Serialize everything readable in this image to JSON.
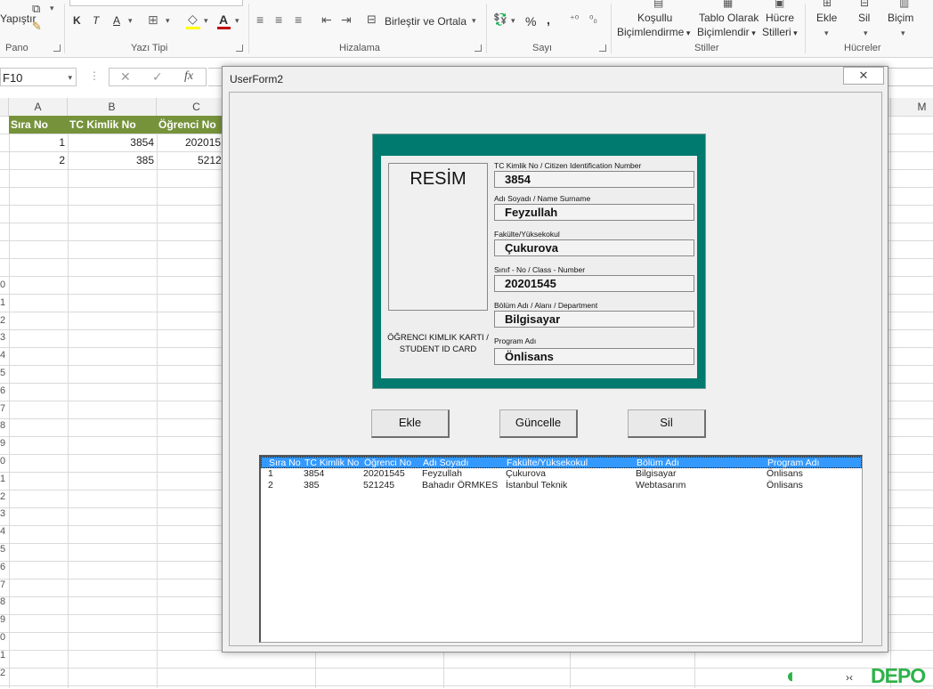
{
  "ribbon": {
    "clipboard": {
      "paste_label": "Yapıştır",
      "group_label": "Pano"
    },
    "font": {
      "group_label": "Yazı Tipi",
      "bold": "K",
      "italic": "T",
      "underline": "A",
      "fill_color": "#ffff00",
      "font_color": "#c00000"
    },
    "alignment": {
      "group_label": "Hizalama",
      "merge_label": "Birleştir ve Ortala"
    },
    "number": {
      "group_label": "Sayı",
      "percent": "%",
      "comma": ","
    },
    "styles": {
      "group_label": "Stiller",
      "conditional_line1": "Koşullu",
      "conditional_line2": "Biçimlendirme",
      "table_line1": "Tablo Olarak",
      "table_line2": "Biçimlendir",
      "cell_line1": "Hücre",
      "cell_line2": "Stilleri"
    },
    "cells": {
      "group_label": "Hücreler",
      "insert": "Ekle",
      "delete": "Sil",
      "format": "Biçim"
    }
  },
  "formula_bar": {
    "name_box": "F10",
    "cancel": "✕",
    "enter": "✓",
    "fx": "fx"
  },
  "sheet": {
    "columns": [
      "A",
      "B",
      "C",
      "M"
    ],
    "headers": [
      "Sıra No",
      "TC Kimlik No",
      "Öğrenci No"
    ],
    "rows": [
      [
        "1",
        "3854",
        "202015"
      ],
      [
        "2",
        "385",
        "5212"
      ]
    ],
    "row_numbers": [
      "0",
      "1",
      "2",
      "3",
      "4",
      "5",
      "6",
      "7",
      "8",
      "9",
      "0",
      "1",
      "2",
      "3",
      "4",
      "5",
      "6",
      "7",
      "8",
      "9",
      "0",
      "1",
      "2"
    ],
    "header_color": "#76933c"
  },
  "form": {
    "title": "UserForm2",
    "close_label": "✕",
    "card": {
      "photo_label": "RESİM",
      "caption_line1": "ÖĞRENCI KIMLIK KARTI /",
      "caption_line2": "STUDENT ID CARD",
      "card_color": "#007a6e",
      "fields": [
        {
          "label": "TC Kimlik No / Citizen Identification Number",
          "value": "3854"
        },
        {
          "label": "Adı Soyadı / Name Surname",
          "value": "Feyzullah"
        },
        {
          "label": "Fakülte/Yüksekokul",
          "value": "Çukurova"
        },
        {
          "label": "Sınıf - No / Class - Number",
          "value": "20201545"
        },
        {
          "label": "Bölüm Adı / Alanı / Department",
          "value": "Bilgisayar"
        },
        {
          "label": "Program Adı",
          "value": "Önlisans"
        }
      ]
    },
    "buttons": {
      "add": "Ekle",
      "update": "Güncelle",
      "delete": "Sil"
    },
    "listbox": {
      "columns": [
        "Sıra No",
        "TC Kimlik No",
        "Öğrenci No",
        "Adı Soyadı",
        "Fakülte/Yüksekokul",
        "Bölüm Adı",
        "Program Adı"
      ],
      "rows": [
        [
          "1",
          "3854",
          "20201545",
          "Feyzullah",
          "Çukurova",
          "Bilgisayar",
          "Önlisans"
        ],
        [
          "2",
          "385",
          "521245",
          "Bahadır ÖRMKES",
          "İstanbul Teknik",
          "Webtasarım",
          "Önlisans"
        ]
      ],
      "selection_color": "#3399ff"
    }
  },
  "watermark": {
    "text": "DEPO",
    "color": "#2db34a"
  }
}
